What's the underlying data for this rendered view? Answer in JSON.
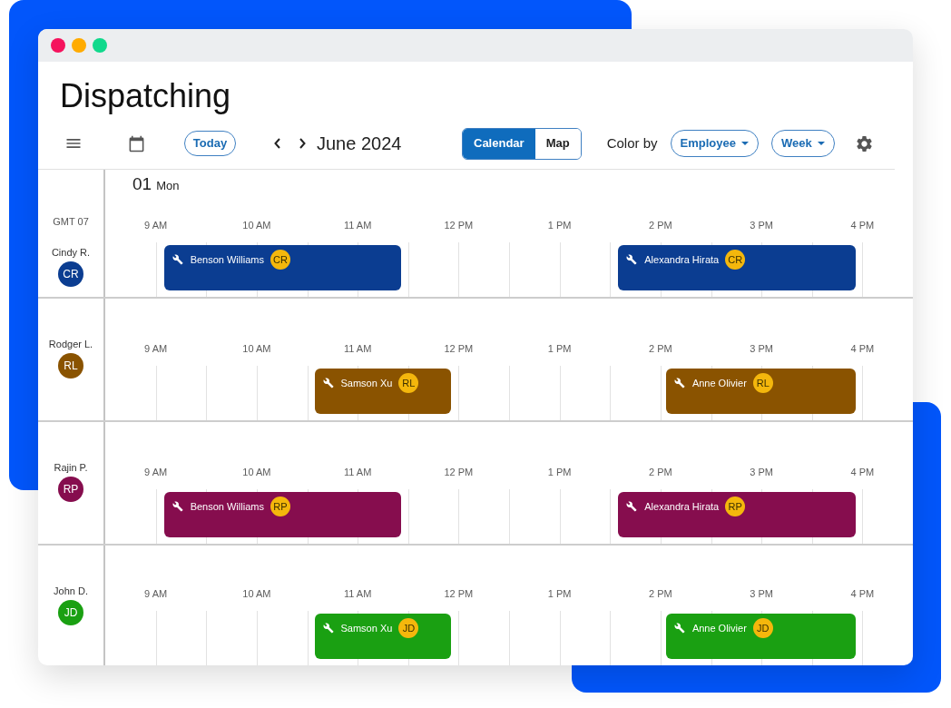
{
  "title": "Dispatching",
  "toolbar": {
    "today": "Today",
    "period": "June 2024",
    "views": [
      {
        "label": "Calendar",
        "selected": true
      },
      {
        "label": "Map",
        "selected": false
      }
    ],
    "color_by": {
      "label": "Color by",
      "value": "Employee"
    },
    "range": "Week"
  },
  "schedule": {
    "day": {
      "number": "01",
      "weekday": "Mon"
    },
    "timezone": "GMT 07",
    "employees": [
      {
        "name": "Cindy R.",
        "initials": "CR",
        "color": "#0b3d91",
        "hours": [
          "9 AM",
          "10 AM",
          "11 AM",
          "12 PM",
          "1 PM",
          "2 PM",
          "3 PM",
          "4 PM"
        ],
        "jobs": [
          {
            "title": "Benson Williams",
            "assignee": "CR"
          },
          {
            "title": "Alexandra Hirata",
            "assignee": "CR"
          }
        ]
      },
      {
        "name": "Rodger L.",
        "initials": "RL",
        "color": "#8a5300",
        "hours": [
          "9 AM",
          "10 AM",
          "11 AM",
          "12 PM",
          "1 PM",
          "2 PM",
          "3 PM",
          "4 PM"
        ],
        "jobs": [
          {
            "title": "Samson Xu",
            "assignee": "RL"
          },
          {
            "title": "Anne Olivier",
            "assignee": "RL"
          }
        ]
      },
      {
        "name": "Rajin P.",
        "initials": "RP",
        "color": "#860d4e",
        "hours": [
          "9 AM",
          "10 AM",
          "11 AM",
          "12 PM",
          "1 PM",
          "2 PM",
          "3 PM",
          "4 PM"
        ],
        "jobs": [
          {
            "title": "Benson Williams",
            "assignee": "RP"
          },
          {
            "title": "Alexandra Hirata",
            "assignee": "RP"
          }
        ]
      },
      {
        "name": "John D.",
        "initials": "JD",
        "color": "#1aa012",
        "hours": [
          "9 AM",
          "10 AM",
          "11 AM",
          "12 PM",
          "1 PM",
          "2 PM",
          "3 PM",
          "4 PM"
        ],
        "jobs": [
          {
            "title": "Samson Xu",
            "assignee": "JD"
          },
          {
            "title": "Anne Olivier",
            "assignee": "JD"
          }
        ]
      }
    ]
  }
}
